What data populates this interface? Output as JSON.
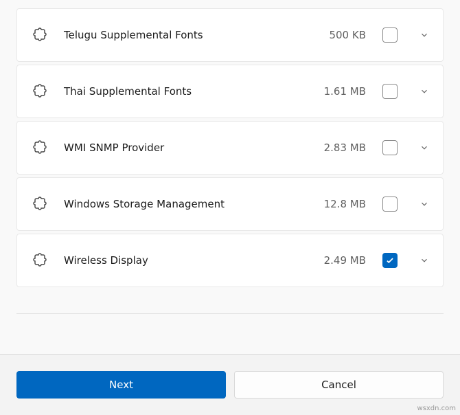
{
  "features": [
    {
      "name": "Telugu Supplemental Fonts",
      "size": "500 KB",
      "checked": false
    },
    {
      "name": "Thai Supplemental Fonts",
      "size": "1.61 MB",
      "checked": false
    },
    {
      "name": "WMI SNMP Provider",
      "size": "2.83 MB",
      "checked": false
    },
    {
      "name": "Windows Storage Management",
      "size": "12.8 MB",
      "checked": false
    },
    {
      "name": "Wireless Display",
      "size": "2.49 MB",
      "checked": true
    }
  ],
  "footer": {
    "next_label": "Next",
    "cancel_label": "Cancel"
  },
  "watermark": "wsxdn.com"
}
